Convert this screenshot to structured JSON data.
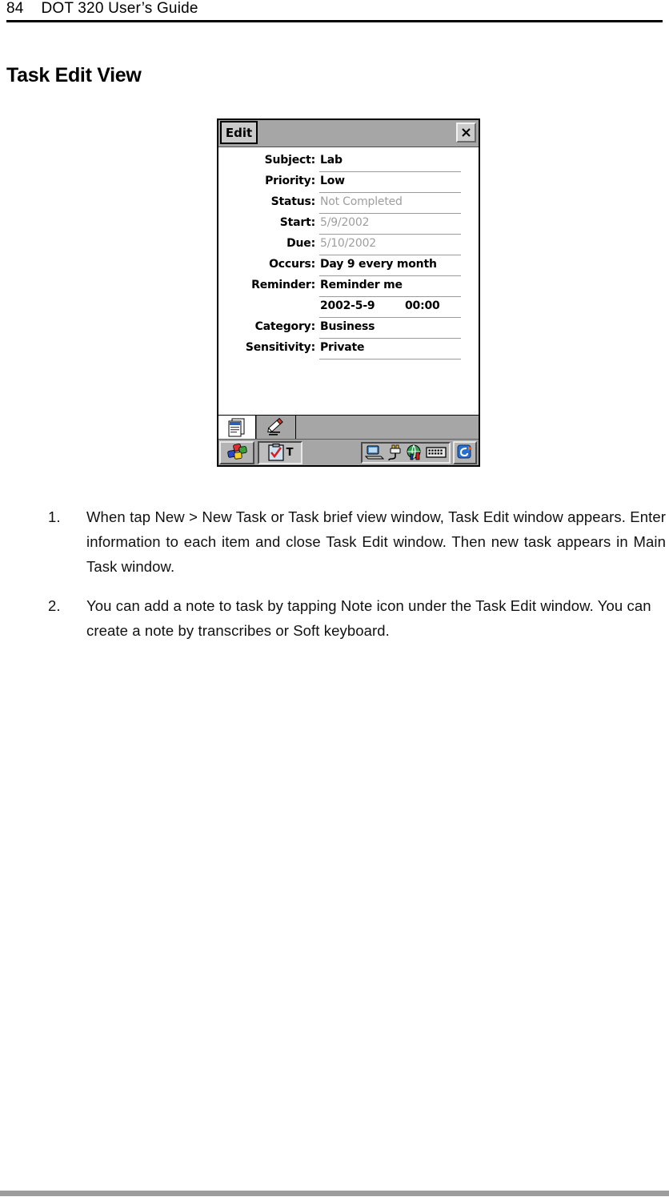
{
  "page": {
    "number": "84",
    "running_head": "DOT 320 User’s Guide",
    "header_text": "84    DOT 320 User’s Guide",
    "heading": "Task Edit View"
  },
  "dialog": {
    "title_button": "Edit",
    "close_icon": "close-icon",
    "fields": [
      {
        "label": "Subject:",
        "value": "Lab",
        "dim": false
      },
      {
        "label": "Priority:",
        "value": "Low",
        "dim": false
      },
      {
        "label": "Status:",
        "value": "Not Completed",
        "dim": true
      },
      {
        "label": "Start:",
        "value": "5/9/2002",
        "dim": true
      },
      {
        "label": "Due:",
        "value": "5/10/2002",
        "dim": true
      },
      {
        "label": "Occurs:",
        "value": "Day 9 every month",
        "dim": false
      },
      {
        "label": "Reminder:",
        "value": "Reminder me",
        "dim": false
      }
    ],
    "reminder_datetime": {
      "label": "",
      "date": "2002-5-9",
      "time": "00:00"
    },
    "fields_after": [
      {
        "label": "Category:",
        "value": "Business",
        "dim": false
      },
      {
        "label": "Sensitivity:",
        "value": "Private",
        "dim": false
      }
    ],
    "toolbar": {
      "note_tab_icon": "note-icon",
      "pen_tab_icon": "pen-icon"
    },
    "taskbar": {
      "start_icon": "windows-flag-icon",
      "task_button_icon": "clipboard-check-icon",
      "task_button_label": "T",
      "tray_icons": [
        "desktop-icon",
        "plug-icon",
        "network-globe-icon",
        "keyboard-icon"
      ],
      "tray_right_icon": "sip-selector-icon"
    },
    "colors": {
      "chrome_gray": "#a6a6a6",
      "dim_text": "#9e9e9e",
      "underline": "#9a9a9a",
      "flag_red": "#e03030",
      "flag_green": "#3aa03a",
      "flag_blue": "#2a46c8",
      "flag_yellow": "#f2d024"
    }
  },
  "instructions": [
    {
      "marker": "1.",
      "text": "When tap New > New Task or Task brief view window, Task Edit window appears. Enter information to each item and close Task Edit window. Then new task appears in Main Task window."
    },
    {
      "marker": "2.",
      "text": "You can add a note to task by tapping Note icon under the Task Edit window. You can create a note by transcribes or Soft keyboard."
    }
  ]
}
